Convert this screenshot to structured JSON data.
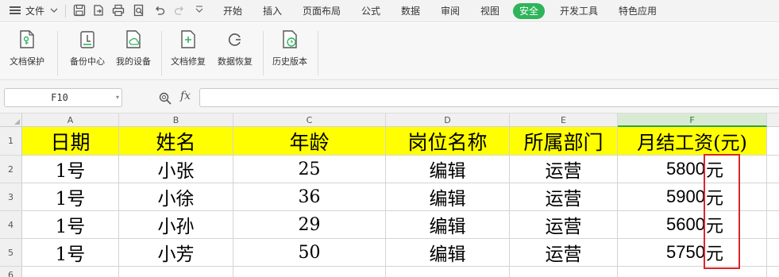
{
  "menubar": {
    "file_label": "文件",
    "tabs": [
      "开始",
      "插入",
      "页面布局",
      "公式",
      "数据",
      "审阅",
      "视图",
      "安全",
      "开发工具",
      "特色应用"
    ],
    "active_tab": "安全",
    "accent_color": "#2fb45a"
  },
  "ribbon": {
    "buttons": [
      {
        "label": "文档保护",
        "icon": "document-protect-icon"
      },
      {
        "label": "备份中心",
        "icon": "backup-center-icon"
      },
      {
        "label": "我的设备",
        "icon": "my-devices-icon"
      },
      {
        "label": "文档修复",
        "icon": "document-repair-icon"
      },
      {
        "label": "数据恢复",
        "icon": "data-recovery-icon"
      },
      {
        "label": "历史版本",
        "icon": "history-version-icon"
      }
    ]
  },
  "formula_bar": {
    "name_box": "F10",
    "fx_label": "fx",
    "formula": ""
  },
  "sheet": {
    "columns": [
      "A",
      "B",
      "C",
      "D",
      "E",
      "F"
    ],
    "selected_column": "F",
    "rows": [
      "1",
      "2",
      "3",
      "4",
      "5",
      "6"
    ],
    "header": [
      "日期",
      "姓名",
      "年龄",
      "岗位名称",
      "所属部门",
      "月结工资(元)"
    ],
    "header_fill": "#ffff00",
    "data": [
      {
        "date": "1号",
        "name": "小张",
        "age": "25",
        "position": "编辑",
        "dept": "运营",
        "salary": "5800",
        "unit": "元"
      },
      {
        "date": "1号",
        "name": "小徐",
        "age": "36",
        "position": "编辑",
        "dept": "运营",
        "salary": "5900",
        "unit": "元"
      },
      {
        "date": "1号",
        "name": "小孙",
        "age": "29",
        "position": "编辑",
        "dept": "运营",
        "salary": "5600",
        "unit": "元"
      },
      {
        "date": "1号",
        "name": "小芳",
        "age": "50",
        "position": "编辑",
        "dept": "运营",
        "salary": "5750",
        "unit": "元"
      }
    ],
    "highlight_color": "#d9262c"
  }
}
